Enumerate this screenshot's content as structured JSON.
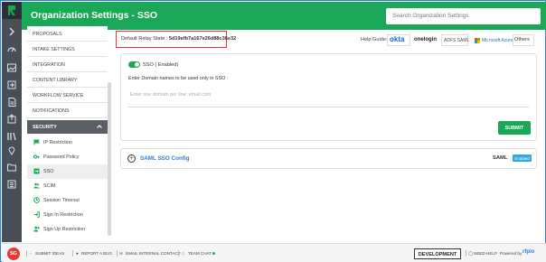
{
  "header": {
    "title": "Organization Settings - SSO",
    "search_placeholder": "Search Organization Settings"
  },
  "nav": {
    "items": [
      "PROPOSALS",
      "INTAKE SETTINGS",
      "INTEGRATION",
      "CONTENT LIBRARY",
      "WORKFLOW SERVICE",
      "NOTIFICATIONS"
    ],
    "section": "SECURITY",
    "sub_items": [
      {
        "label": "IP Restriction",
        "icon": "flag-icon"
      },
      {
        "label": "Password Policy",
        "icon": "key-icon"
      },
      {
        "label": "SSO",
        "icon": "login-icon",
        "active": true
      },
      {
        "label": "SCIM",
        "icon": "users-icon"
      },
      {
        "label": "Session Timeout",
        "icon": "clock-icon"
      },
      {
        "label": "Sign In Restriction",
        "icon": "sign-in-icon"
      },
      {
        "label": "Sign Up Restriction",
        "icon": "user-plus-icon"
      }
    ]
  },
  "relay": {
    "label": "Default Relay State :",
    "value": "5d19efb7a167e26d88c36e32"
  },
  "help_guide": {
    "label": "Help Guide:",
    "okta": "okta",
    "onelogin": "onelogin",
    "adfs": "ADFS SAML",
    "azure": "Microsoft Azure",
    "others": "Others"
  },
  "sso": {
    "toggle_label": "SSO ( Enabled)",
    "toggle_on": true,
    "domains_label": "Enter Domain names to be used only in SSO :",
    "domains_placeholder": "Enter one domain per line: email.com",
    "submit_label": "SUBMIT"
  },
  "saml": {
    "title": "SAML SSO Config",
    "type": "SAML",
    "badge": "Enabled"
  },
  "footer": {
    "avatar": "SG",
    "submit_ideas": "SUBMIT IDEAS",
    "report_bug": "REPORT A BUG",
    "email_contact": "EMAIL INTERNAL CONTACT",
    "team_chat": "TEAM CHAT",
    "environment": "DEVELOPMENT",
    "need_help": "NEED HELP",
    "powered_by": "Powered by",
    "brand": "rfpio"
  },
  "colors": {
    "brand_green": "#1aa757",
    "highlight_red": "#e53935",
    "link_blue": "#2f80c9",
    "badge_blue": "#2fa8e0",
    "rail_dark": "#4a4f57"
  }
}
